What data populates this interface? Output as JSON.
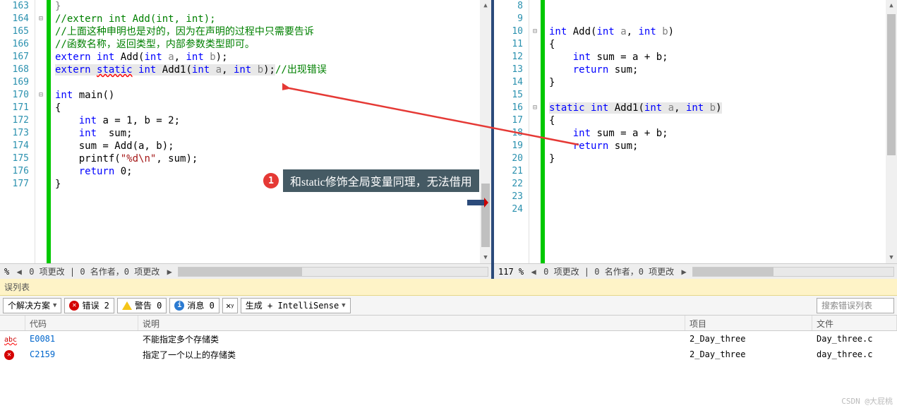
{
  "left_editor": {
    "lines": [
      {
        "num": "163",
        "marker": "",
        "html": "<span class='gray'>}</span>"
      },
      {
        "num": "164",
        "marker": "⊟",
        "html": "<span class='green'>//extern int Add(int, int);</span>"
      },
      {
        "num": "165",
        "marker": "",
        "html": "<span class='green'>//上面这种申明也是对的，因为在声明的过程中只需要告诉</span>"
      },
      {
        "num": "166",
        "marker": "",
        "html": "<span class='green'>//函数名称，返回类型，内部参数类型即可。</span>"
      },
      {
        "num": "167",
        "marker": "",
        "html": "<span class='blue'>extern</span> <span class='blue'>int</span> <span class='black'>Add(</span><span class='blue'>int</span> <span class='gray'>a</span>, <span class='blue'>int</span> <span class='gray'>b</span><span class='black'>);</span>"
      },
      {
        "num": "168",
        "marker": "",
        "html": "<span class='hl'><span class='blue'>extern</span> <span class='blue sq-err'>static</span> <span class='blue'>int</span> <span class='black'>Add1(</span><span class='blue'>int</span> <span class='gray'>a</span>, <span class='blue'>int</span> <span class='gray'>b</span><span class='black'>);</span></span><span class='green'>//出现错误</span>"
      },
      {
        "num": "169",
        "marker": "",
        "html": ""
      },
      {
        "num": "170",
        "marker": "⊟",
        "html": "<span class='blue'>int</span> <span class='black'>main()</span>"
      },
      {
        "num": "171",
        "marker": "",
        "html": "<span class='black'>{</span>"
      },
      {
        "num": "172",
        "marker": "",
        "html": "    <span class='blue'>int</span> <span class='black'>a = 1, b = 2;</span>"
      },
      {
        "num": "173",
        "marker": "",
        "html": "    <span class='blue'>int</span>  <span class='black'>sum;</span>"
      },
      {
        "num": "174",
        "marker": "",
        "html": "    <span class='black'>sum = Add(a, b);</span>"
      },
      {
        "num": "175",
        "marker": "",
        "html": "    <span class='black'>printf(</span><span class='maroon'>\"%d\\n\"</span><span class='black'>, sum);</span>"
      },
      {
        "num": "176",
        "marker": "",
        "html": "    <span class='blue'>return</span> <span class='black'>0;</span>"
      },
      {
        "num": "177",
        "marker": "",
        "html": "<span class='black'>}</span>"
      }
    ],
    "zoom": "%",
    "status": "0 项更改 | 0 名作者，0 项更改"
  },
  "right_editor": {
    "lines": [
      {
        "num": "8",
        "marker": "",
        "html": ""
      },
      {
        "num": "9",
        "marker": "",
        "html": ""
      },
      {
        "num": "10",
        "marker": "⊟",
        "html": "<span class='blue'>int</span> <span class='black'>Add(</span><span class='blue'>int</span> <span class='gray'>a</span>, <span class='blue'>int</span> <span class='gray'>b</span><span class='black'>)</span>"
      },
      {
        "num": "11",
        "marker": "",
        "html": "<span class='black'>{</span>"
      },
      {
        "num": "12",
        "marker": "",
        "html": "    <span class='blue'>int</span> <span class='black'>sum = a + b;</span>"
      },
      {
        "num": "13",
        "marker": "",
        "html": "    <span class='blue'>return</span> <span class='black'>sum;</span>"
      },
      {
        "num": "14",
        "marker": "",
        "html": "<span class='black'>}</span>"
      },
      {
        "num": "15",
        "marker": "",
        "html": ""
      },
      {
        "num": "16",
        "marker": "⊟",
        "html": "<span class='hl'><span class='blue'>static</span> <span class='blue'>int</span> <span class='black'>Add1(</span><span class='blue'>int</span> <span class='gray'>a</span>, <span class='blue'>int</span> <span class='gray'>b</span><span class='black'>)</span></span>"
      },
      {
        "num": "17",
        "marker": "",
        "html": "<span class='black'>{</span>"
      },
      {
        "num": "18",
        "marker": "",
        "html": "    <span class='blue'>int</span> <span class='black'>sum = a + b;</span>"
      },
      {
        "num": "19",
        "marker": "",
        "html": "    <span class='blue'>return</span> <span class='black'>sum;</span>"
      },
      {
        "num": "20",
        "marker": "",
        "html": "<span class='black'>}</span>"
      },
      {
        "num": "21",
        "marker": "",
        "html": ""
      },
      {
        "num": "22",
        "marker": "",
        "html": ""
      },
      {
        "num": "23",
        "marker": "",
        "html": ""
      },
      {
        "num": "24",
        "marker": "",
        "html": ""
      }
    ],
    "zoom": "117 %",
    "status": "0 项更改 | 0 名作者，0 项更改"
  },
  "annotation": {
    "badge": "1",
    "text": "和static修饰全局变量同理，无法借用"
  },
  "error_panel": {
    "header": "误列表",
    "solution_dd": "个解决方案",
    "errors_label": "错误 2",
    "warnings_label": "警告 0",
    "messages_label": "消息 0",
    "build_dd": "生成 + IntelliSense",
    "search_placeholder": "搜索错误列表",
    "columns": {
      "code": "代码",
      "desc": "说明",
      "proj": "项目",
      "file": "文件"
    },
    "rows": [
      {
        "icon": "abc",
        "code": "E0081",
        "desc": "不能指定多个存储类",
        "proj": "2_Day_three",
        "file": "Day_three.c"
      },
      {
        "icon": "err",
        "code": "C2159",
        "desc": "指定了一个以上的存储类",
        "proj": "2_Day_three",
        "file": "day_three.c"
      }
    ]
  },
  "watermark": "CSDN @大屁桃",
  "nav": {
    "left": "◀",
    "right": "▶"
  }
}
